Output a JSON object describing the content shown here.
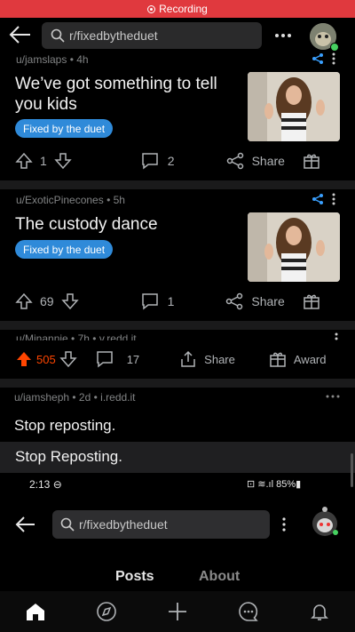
{
  "recording": {
    "label": "Recording"
  },
  "header": {
    "search_text": "r/fixedbytheduet"
  },
  "posts": [
    {
      "user": "u/jamslaps",
      "age": "4h",
      "title": "We’ve got something to tell you kids",
      "flair": "Fixed by the duet",
      "upvotes": "1",
      "comments": "2",
      "share": "Share"
    },
    {
      "user": "u/ExoticPinecones",
      "age": "5h",
      "title": "The custody dance",
      "flair": "Fixed by the duet",
      "upvotes": "69",
      "comments": "1",
      "share": "Share"
    },
    {
      "user": "u/Minannie",
      "age": "7h",
      "domain": "v.redd.it",
      "upvotes": "505",
      "comments": "17",
      "share": "Share",
      "award": "Award"
    },
    {
      "user": "u/iamsheph",
      "age": "2d",
      "domain": "i.redd.it",
      "title": "Stop reposting.",
      "image_text": "Stop Reposting."
    }
  ],
  "phone": {
    "time": "2:13",
    "battery": "85%",
    "search_text": "r/fixedbytheduet",
    "tabs": [
      "Posts",
      "About"
    ]
  },
  "colors": {
    "accent": "#2f8ad9",
    "upvote": "#ff4500",
    "recording": "#e0393e"
  }
}
